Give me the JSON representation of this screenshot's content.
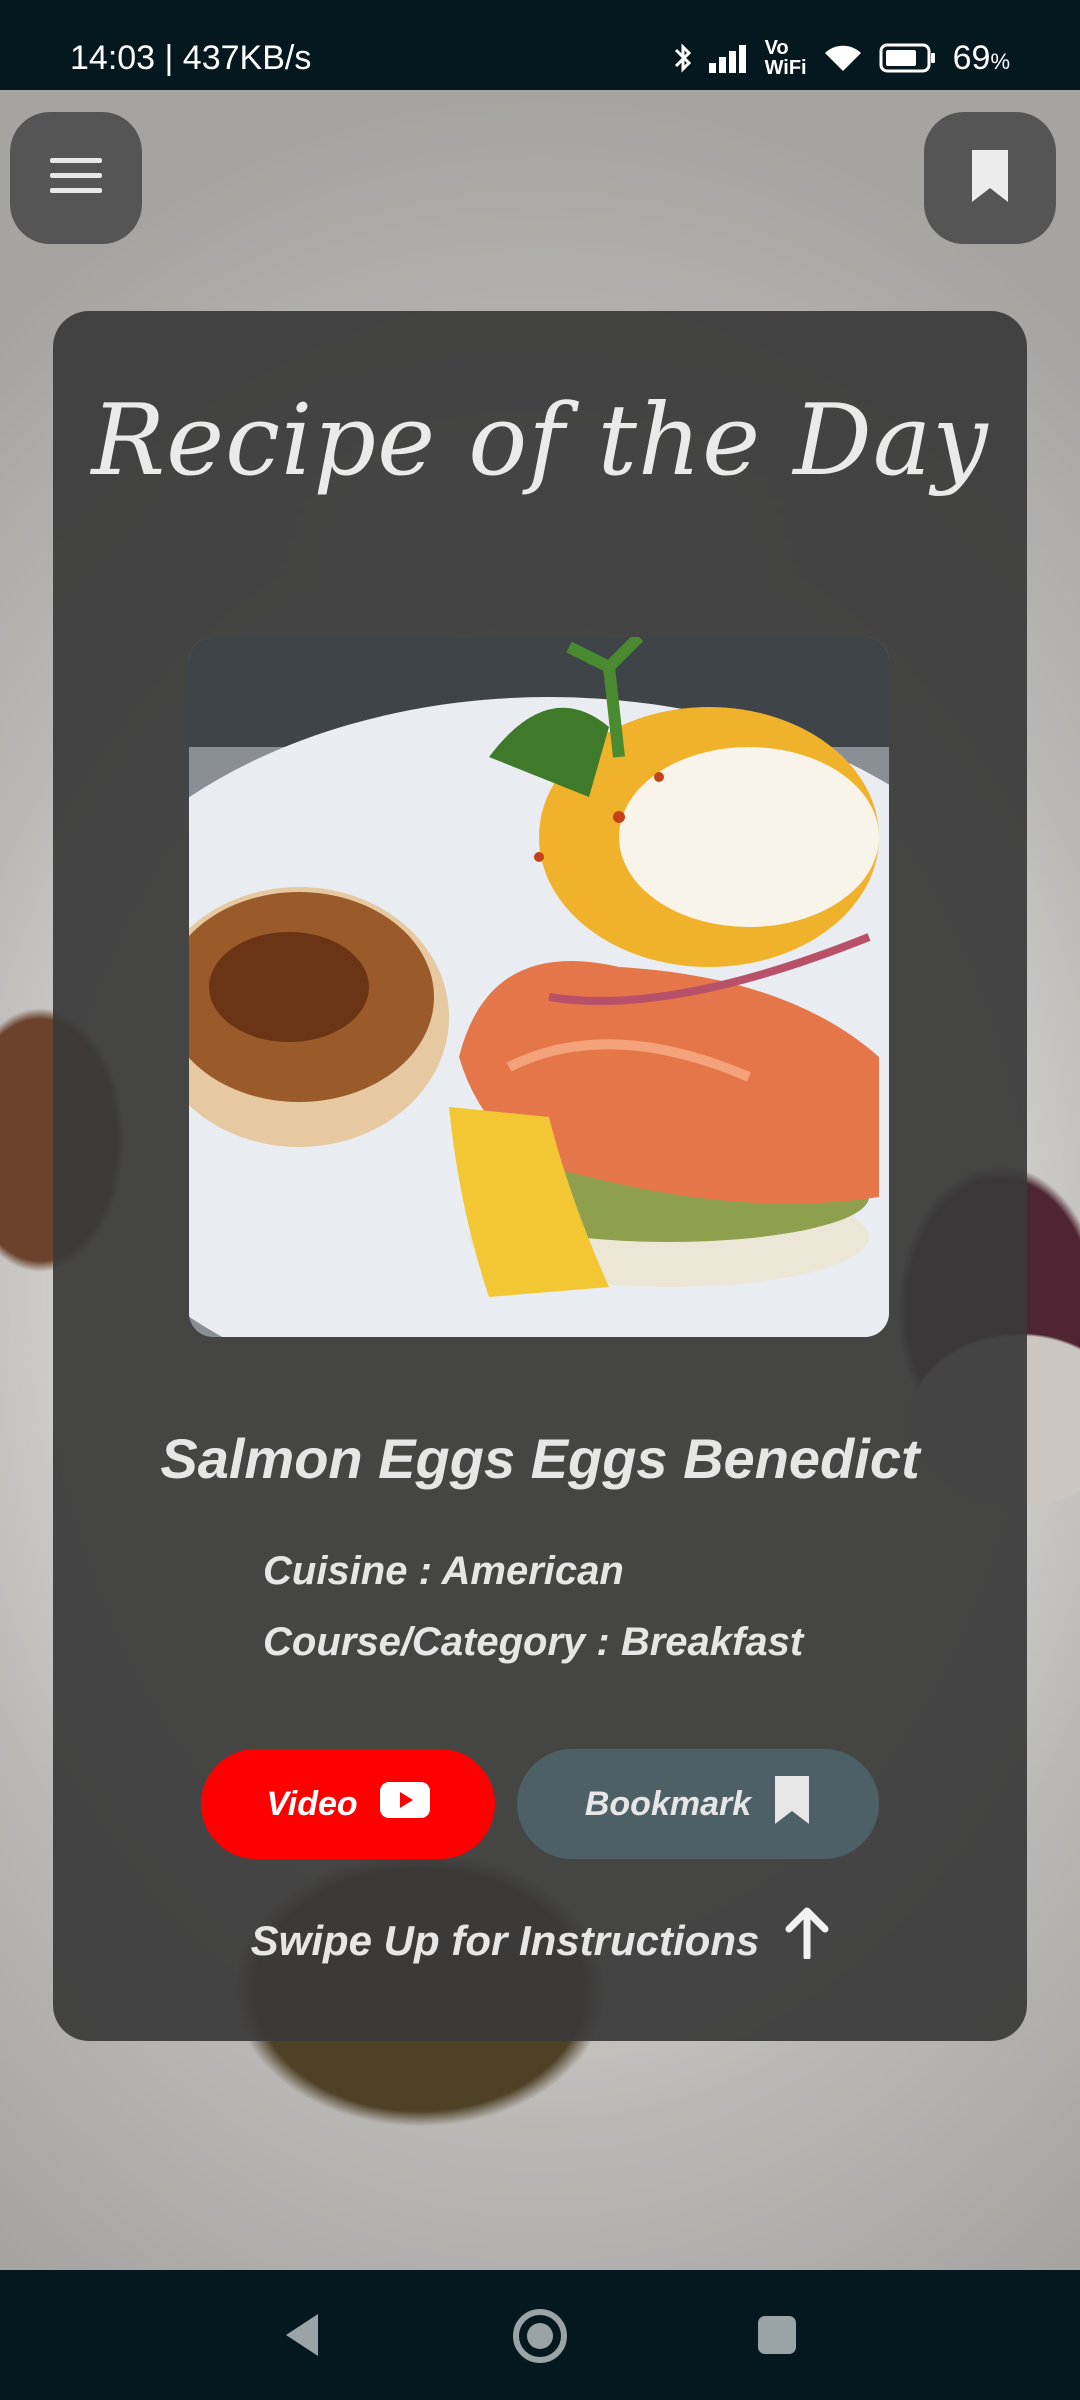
{
  "status_bar": {
    "time_speed": "14:03 | 437KB/s",
    "battery_percent": "69",
    "battery_unit": "%",
    "vo_line1": "Vo",
    "vo_line2": "WiFi",
    "icons": [
      "bluetooth-icon",
      "signal-icon",
      "vowifi-icon",
      "wifi-icon",
      "battery-icon"
    ]
  },
  "header": {
    "menu_icon": "hamburger-menu-icon",
    "bookmark_icon": "bookmark-icon"
  },
  "card": {
    "title": "Recipe of the Day",
    "recipe_name": "Salmon Eggs Eggs Benedict",
    "cuisine": "Cuisine : American",
    "course": "Course/Category : Breakfast",
    "video_label": "Video",
    "bookmark_label": "Bookmark",
    "swipe_hint": "Swipe Up for Instructions"
  },
  "colors": {
    "video_button": "#ff0000",
    "bookmark_button": "#4d6066",
    "card_background": "#3a3a3a",
    "system_bar": "#05181f"
  },
  "nav_bar": {
    "icons": [
      "back-icon",
      "home-icon",
      "recents-icon"
    ]
  }
}
